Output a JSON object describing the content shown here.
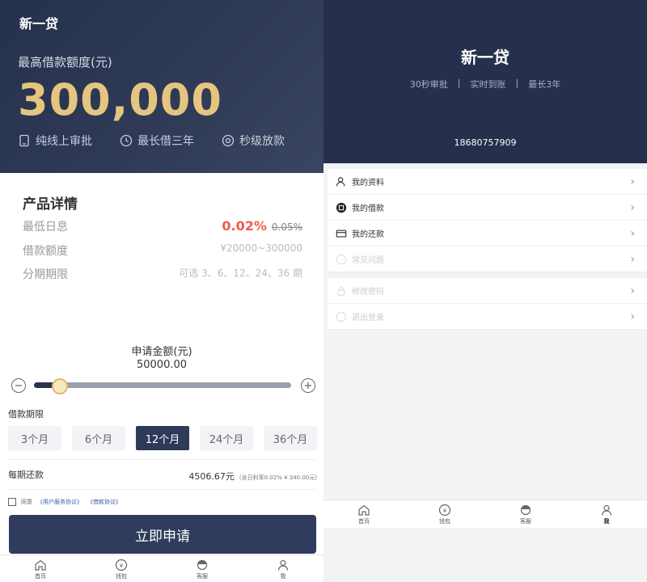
{
  "left": {
    "brand": "新一贷",
    "hero": {
      "max_label": "最高借款额度(元)",
      "max_amount": "300,000",
      "features": [
        "纯线上审批",
        "最长借三年",
        "秒级放款"
      ]
    },
    "details": {
      "title": "产品详情",
      "rows": [
        {
          "key": "最低日息",
          "value_main": "0.02%",
          "value_old": "0.05%"
        },
        {
          "key": "借款额度",
          "value": "¥20000~300000"
        },
        {
          "key": "分期期限",
          "value": "可选 3、6、12、24、36 期"
        }
      ]
    },
    "apply": {
      "label": "申请金额(元)",
      "value": "50000.00",
      "slider_fraction": 0.1,
      "minus": "−",
      "plus": "+"
    },
    "term": {
      "label": "借款期限",
      "options": [
        "3个月",
        "6个月",
        "12个月",
        "24个月",
        "36个月"
      ],
      "selected": "12个月"
    },
    "repay": {
      "label": "每期还款",
      "value": "4506.67元",
      "note": "(含日利率0.02% ¥ 340.00元)"
    },
    "agreement": {
      "prefix": "同意",
      "link1": "《用户服务协议》",
      "link2": "《借款协议》"
    },
    "submit_label": "立即申请",
    "tabs": [
      "首页",
      "钱包",
      "客服",
      "我"
    ]
  },
  "right": {
    "brand": "新一贷",
    "slogan": [
      "30秒审批",
      "实时到账",
      "最长3年"
    ],
    "phone": "18680757909",
    "menu": [
      {
        "label": "我的资料",
        "icon": "user-icon"
      },
      {
        "label": "我的借款",
        "icon": "loan-icon"
      },
      {
        "label": "我的还款",
        "icon": "card-icon"
      },
      {
        "label": "常见问题",
        "icon": "question-icon"
      },
      {
        "label": "修改密码",
        "icon": "lock-icon"
      },
      {
        "label": "退出登录",
        "icon": "logout-icon"
      }
    ],
    "tabs": [
      "首页",
      "钱包",
      "客服",
      "我"
    ]
  },
  "colors": {
    "hero_bg": "#25314d",
    "gold": "#e5c57f",
    "accent_red": "#f05a4a",
    "button_bg": "#303c5d"
  }
}
